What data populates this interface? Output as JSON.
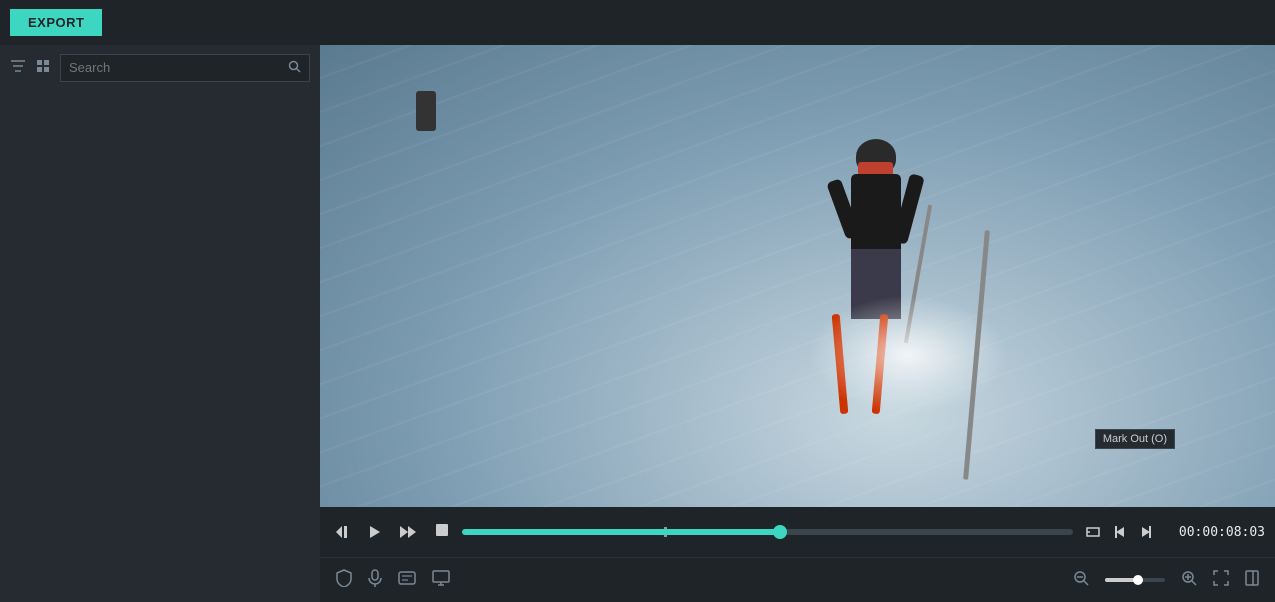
{
  "header": {
    "export_label": "EXPORT"
  },
  "left_panel": {
    "search_placeholder": "Search"
  },
  "playback": {
    "time_display": "00:00:08:03",
    "progress_percent": 52
  },
  "tooltip": {
    "mark_out_label": "Mark Out (O)"
  },
  "icons": {
    "filter": "⊟",
    "grid": "⊞",
    "search": "🔍",
    "skip_back": "◀",
    "play": "▶",
    "play_fast": "▶",
    "stop": "■",
    "mark_in": "{",
    "mark_out": "}",
    "frame_back": "←",
    "volume": "🔊",
    "subtitle": "≡",
    "captions": "CC",
    "chaptermark": "◇",
    "zoom_out": "−",
    "zoom_in": "+",
    "expand": "⤢",
    "shield": "⛉",
    "mic": "🎤",
    "list": "☰",
    "monitor": "⊡",
    "vertical_bar": "▐"
  }
}
